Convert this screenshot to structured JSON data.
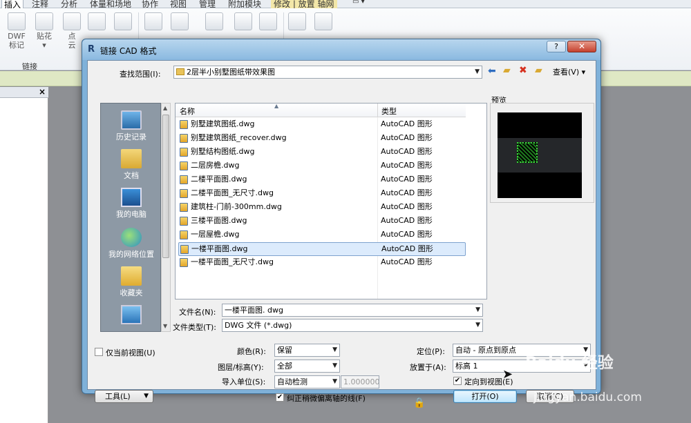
{
  "ribbon": {
    "tabs": [
      "插入",
      "注释",
      "分析",
      "体量和场地",
      "协作",
      "视图",
      "管理",
      "附加模块",
      "修改 | 放置 轴网"
    ],
    "buttons": [
      {
        "label": "DWF 标记",
        "sub": ""
      },
      {
        "label": "贴花",
        "sub": "▾"
      },
      {
        "label": "点",
        "sub": "云"
      },
      {
        "label": "",
        "sub": ""
      },
      {
        "label": "",
        "sub": ""
      },
      {
        "label": "",
        "sub": ""
      },
      {
        "label": "",
        "sub": ""
      },
      {
        "label": "",
        "sub": ""
      },
      {
        "label": "",
        "sub": ""
      },
      {
        "label": "",
        "sub": ""
      },
      {
        "label": "",
        "sub": ""
      },
      {
        "label": "",
        "sub": ""
      }
    ],
    "group_label": "链接"
  },
  "left_panel": {
    "close": "×"
  },
  "dialog": {
    "logo": "R",
    "title": "链接 CAD 格式",
    "help": "?",
    "close": "✕",
    "lookin_label": "查找范围(I):",
    "lookin_value": "2层半小别墅图纸带效果图",
    "toolbar": {
      "back_icon": "arrow-left-icon",
      "up_icon": "folder-up-icon",
      "delete_icon": "delete-x-icon",
      "newfolder_icon": "new-folder-icon",
      "view_label": "查看(V)"
    },
    "places": [
      "历史记录",
      "文档",
      "我的电脑",
      "我的网络位置",
      "收藏夹",
      ""
    ],
    "columns": {
      "name": "名称",
      "type": "类型"
    },
    "files": [
      {
        "name": "别墅建筑图纸.dwg",
        "type": "AutoCAD 图形",
        "selected": false
      },
      {
        "name": "别墅建筑图纸_recover.dwg",
        "type": "AutoCAD 图形",
        "selected": false
      },
      {
        "name": "别墅结构图纸.dwg",
        "type": "AutoCAD 图形",
        "selected": false
      },
      {
        "name": "二层房檐.dwg",
        "type": "AutoCAD 图形",
        "selected": false
      },
      {
        "name": "二楼平面图.dwg",
        "type": "AutoCAD 图形",
        "selected": false
      },
      {
        "name": "二楼平面图_无尺寸.dwg",
        "type": "AutoCAD 图形",
        "selected": false
      },
      {
        "name": "建筑柱-门前-300mm.dwg",
        "type": "AutoCAD 图形",
        "selected": false
      },
      {
        "name": "三楼平面图.dwg",
        "type": "AutoCAD 图形",
        "selected": false
      },
      {
        "name": "一层屋檐.dwg",
        "type": "AutoCAD 图形",
        "selected": false
      },
      {
        "name": "一楼平面图.dwg",
        "type": "AutoCAD 图形",
        "selected": true
      },
      {
        "name": "一楼平面图_无尺寸.dwg",
        "type": "AutoCAD 图形",
        "selected": false
      }
    ],
    "preview_label": "预览",
    "filename_label": "文件名(N):",
    "filename_value": "一楼平面图. dwg",
    "filetype_label": "文件类型(T):",
    "filetype_value": "DWG 文件 (*.dwg)",
    "current_view_only": {
      "label": "仅当前视图(U)",
      "checked": false
    },
    "color_label": "颜色(R):",
    "color_value": "保留",
    "layers_label": "图层/标高(Y):",
    "layers_value": "全部",
    "units_label": "导入单位(S):",
    "units_value": "自动检测",
    "units_factor": "1.000000",
    "correct_lines": {
      "label": "纠正稍微偏离轴的线(F)",
      "checked": true
    },
    "position_label": "定位(P):",
    "position_value": "自动 - 原点到原点",
    "place_at_label": "放置于(A):",
    "place_at_value": "标高 1",
    "orient_to_view": {
      "label": "定向到视图(E)",
      "checked": true
    },
    "tools_label": "工具(L)",
    "open_label": "打开(O)",
    "cancel_label": "取消(C)"
  },
  "watermark": {
    "brand": "Baidu 经验",
    "url": "jingyan.baidu.com"
  }
}
